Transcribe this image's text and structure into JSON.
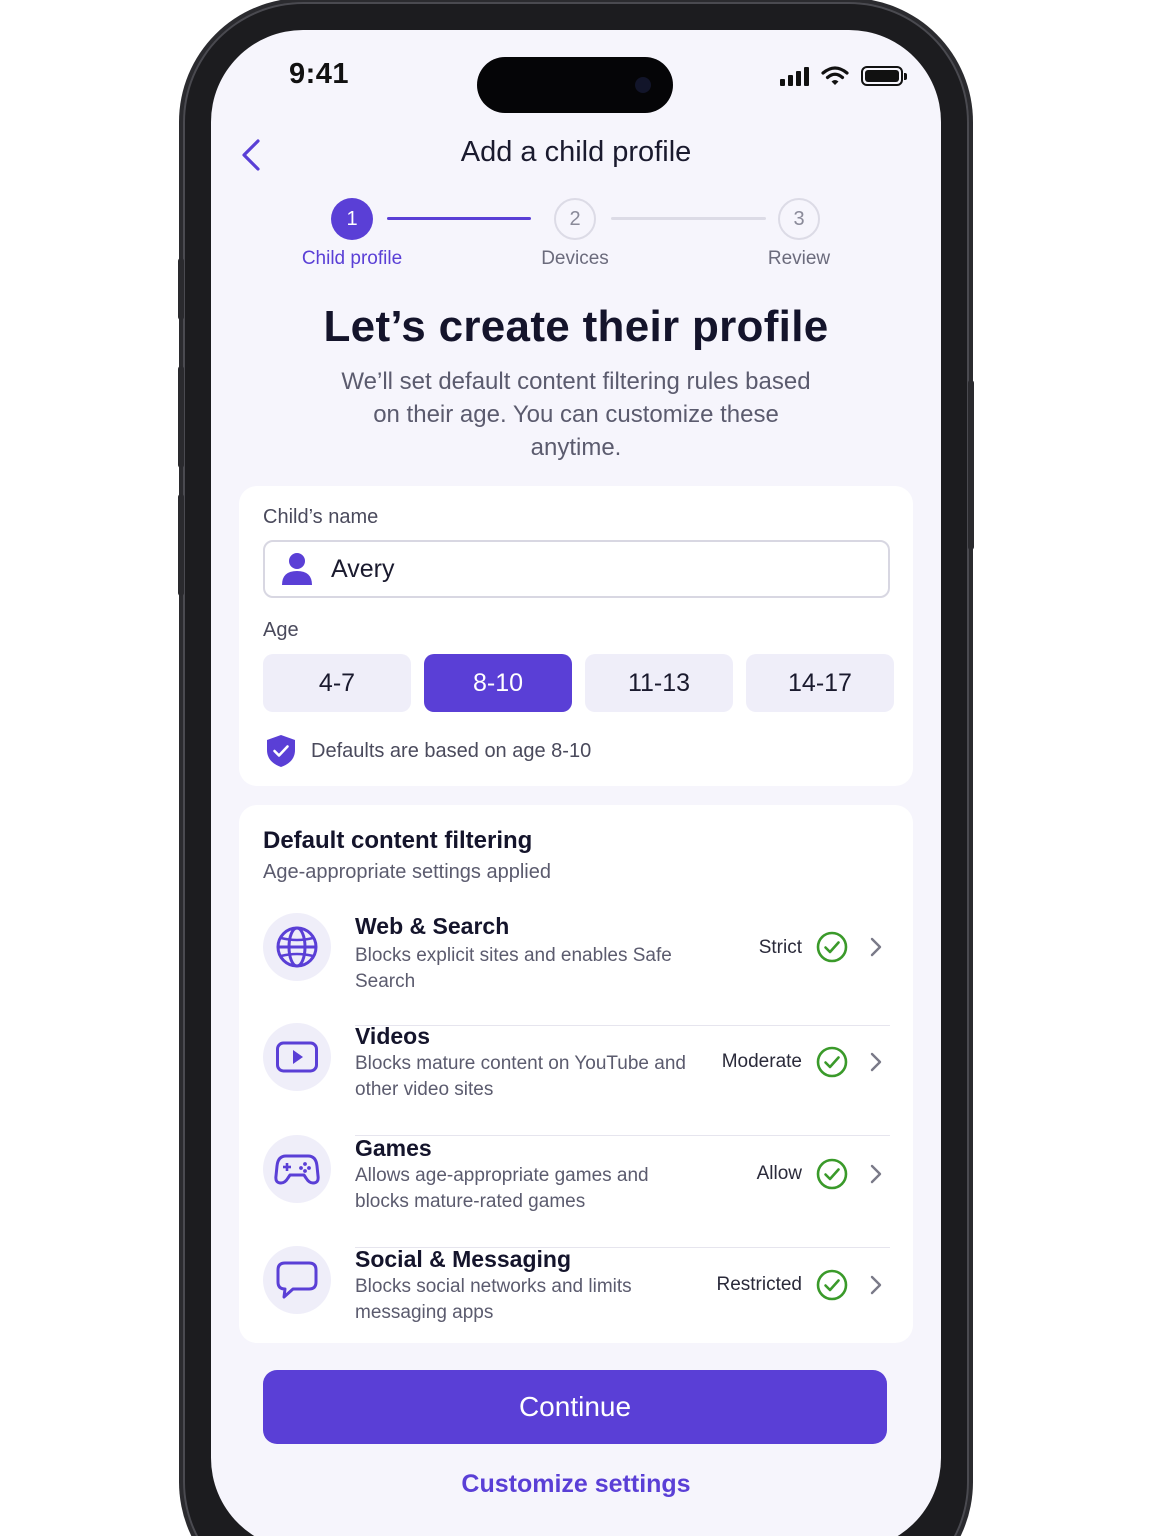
{
  "status_bar": {
    "time": "9:41"
  },
  "header": {
    "title": "Add a child profile"
  },
  "stepper": {
    "steps": [
      {
        "number": "1",
        "label": "Child profile",
        "state": "active"
      },
      {
        "number": "2",
        "label": "Devices",
        "state": "inactive"
      },
      {
        "number": "3",
        "label": "Review",
        "state": "inactive"
      }
    ]
  },
  "intro": {
    "headline": "Let’s create their profile",
    "description": "We’ll set default content filtering rules based on their age. You can customize these anytime."
  },
  "profile_form": {
    "name_label": "Child’s name",
    "name_value": "Avery",
    "age_label": "Age",
    "age_options": [
      "4-7",
      "8-10",
      "11-13",
      "14-17"
    ],
    "selected_age": "8-10",
    "defaults_note": "Defaults are based on age 8-10"
  },
  "filtering": {
    "title": "Default content filtering",
    "subtitle": "Age-appropriate settings applied",
    "items": [
      {
        "icon": "globe-icon",
        "name": "Web & Search",
        "description": "Blocks explicit sites and enables Safe Search",
        "level": "Strict"
      },
      {
        "icon": "video-play-icon",
        "name": "Videos",
        "description": "Blocks mature content on YouTube and other video sites",
        "level": "Moderate"
      },
      {
        "icon": "gamepad-icon",
        "name": "Games",
        "description": "Allows age-appropriate games and blocks mature-rated games",
        "level": "Allow"
      },
      {
        "icon": "chat-bubble-icon",
        "name": "Social & Messaging",
        "description": "Blocks social networks and limits messaging apps",
        "level": "Restricted"
      }
    ]
  },
  "actions": {
    "continue_label": "Continue",
    "customize_label": "Customize settings"
  },
  "colors": {
    "accent": "#5a3fd6",
    "check_green": "#3a9a2a",
    "background": "#f6f5fc"
  }
}
